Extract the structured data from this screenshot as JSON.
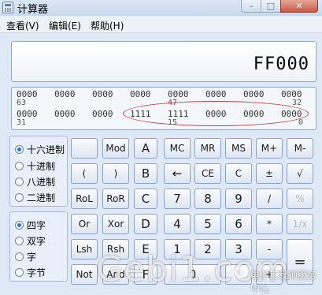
{
  "window": {
    "title": "计算器",
    "minimize": "–",
    "maximize": "□",
    "close": "✕"
  },
  "menu": [
    "查看(V)",
    "编辑(E)",
    "帮助(H)"
  ],
  "display": {
    "value": "FF000"
  },
  "bits": {
    "row1": [
      "0000",
      "0000",
      "0000",
      "0000",
      "0000",
      "0000",
      "0000",
      "0000"
    ],
    "row1_idx": [
      "63",
      "47",
      "32"
    ],
    "row2": [
      "0000",
      "0000",
      "0000",
      "1111",
      "1111",
      "0000",
      "0000",
      "0000"
    ],
    "row2_idx": [
      "31",
      "15",
      "0"
    ]
  },
  "radix": {
    "selected": "hex",
    "options": [
      "十六进制",
      "十进制",
      "八进制",
      "二进制"
    ]
  },
  "wordsize": {
    "selected": "qword",
    "options": [
      "四字",
      "双字",
      "字",
      "字节"
    ]
  },
  "keys": {
    "r1": [
      "",
      "Mod",
      "A",
      "MC",
      "MR",
      "MS",
      "M+",
      "M-"
    ],
    "r2": [
      "(",
      ")",
      "B",
      "←",
      "CE",
      "C",
      "±",
      "√"
    ],
    "r3": [
      "RoL",
      "RoR",
      "C",
      "7",
      "8",
      "9",
      "/",
      "%"
    ],
    "r4": [
      "Or",
      "Xor",
      "D",
      "4",
      "5",
      "6",
      "*",
      "1/x"
    ],
    "r5": [
      "Lsh",
      "Rsh",
      "E",
      "1",
      "2",
      "3",
      "-",
      "="
    ],
    "r6": [
      "Not",
      "And",
      "F",
      "0",
      "",
      "."
    ],
    "r6_plus": "+"
  },
  "watermark": {
    "text": "Gebi1.com",
    "sub": "电子工程师服务中心"
  }
}
